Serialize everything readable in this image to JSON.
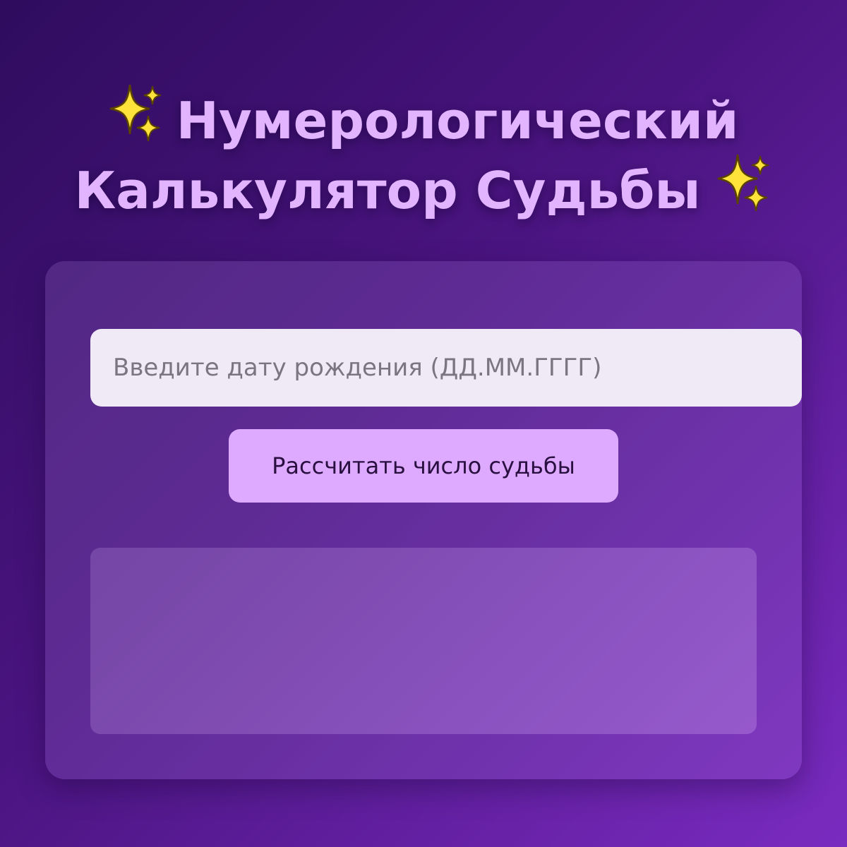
{
  "header": {
    "title_line1": "Нумерологический",
    "title_line2": "Калькулятор Судьбы",
    "decor_icon": "sparkles-icon"
  },
  "form": {
    "date_placeholder": "Введите дату рождения (ДД.ММ.ГГГГ)",
    "date_value": "",
    "submit_label": "Рассчитать число судьбы"
  },
  "result": {
    "text": ""
  },
  "colors": {
    "title": "#e2b4ff",
    "button": "#ddaaff",
    "input": "#efeaf6",
    "sparkle": "#ffe23a"
  }
}
